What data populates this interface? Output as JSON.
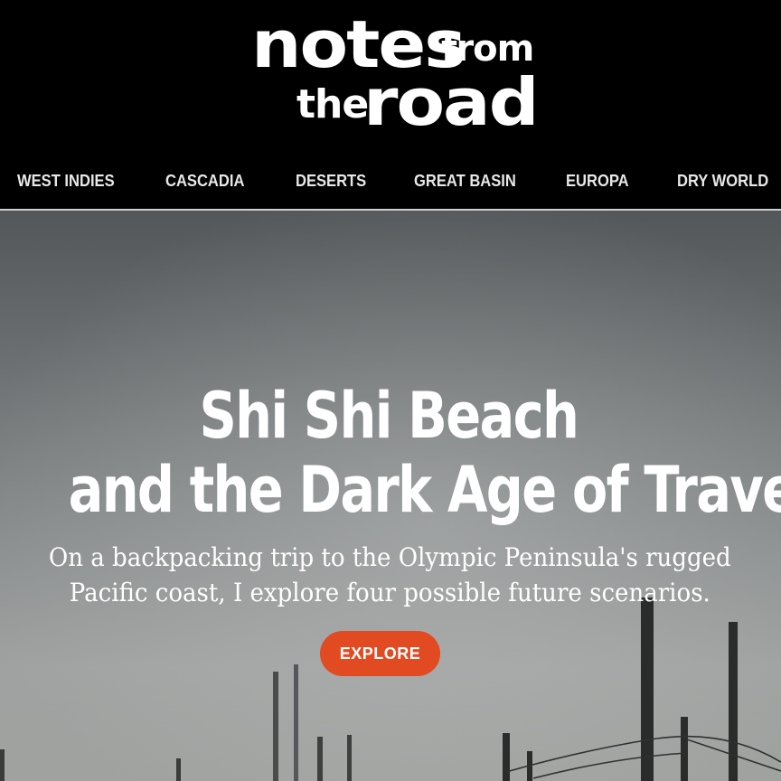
{
  "site": {
    "logo": {
      "word_notes": "notes",
      "word_from": "from",
      "word_the": "the",
      "word_road": "road"
    },
    "nav": [
      {
        "label": "WEST INDIES"
      },
      {
        "label": "CASCADIA"
      },
      {
        "label": "DESERTS"
      },
      {
        "label": "GREAT BASIN"
      },
      {
        "label": "EUROPA"
      },
      {
        "label": "DRY WORLD"
      }
    ]
  },
  "hero": {
    "title_line_1": "Shi Shi Beach",
    "title_line_2": "and the Dark Age of Travel",
    "subtitle_line_1": "On a backpacking trip to the Olympic Peninsula's rugged",
    "subtitle_line_2": "Pacific coast, I explore four possible future scenarios.",
    "button_label": "EXPLORE",
    "button_color": "#e24a22"
  }
}
